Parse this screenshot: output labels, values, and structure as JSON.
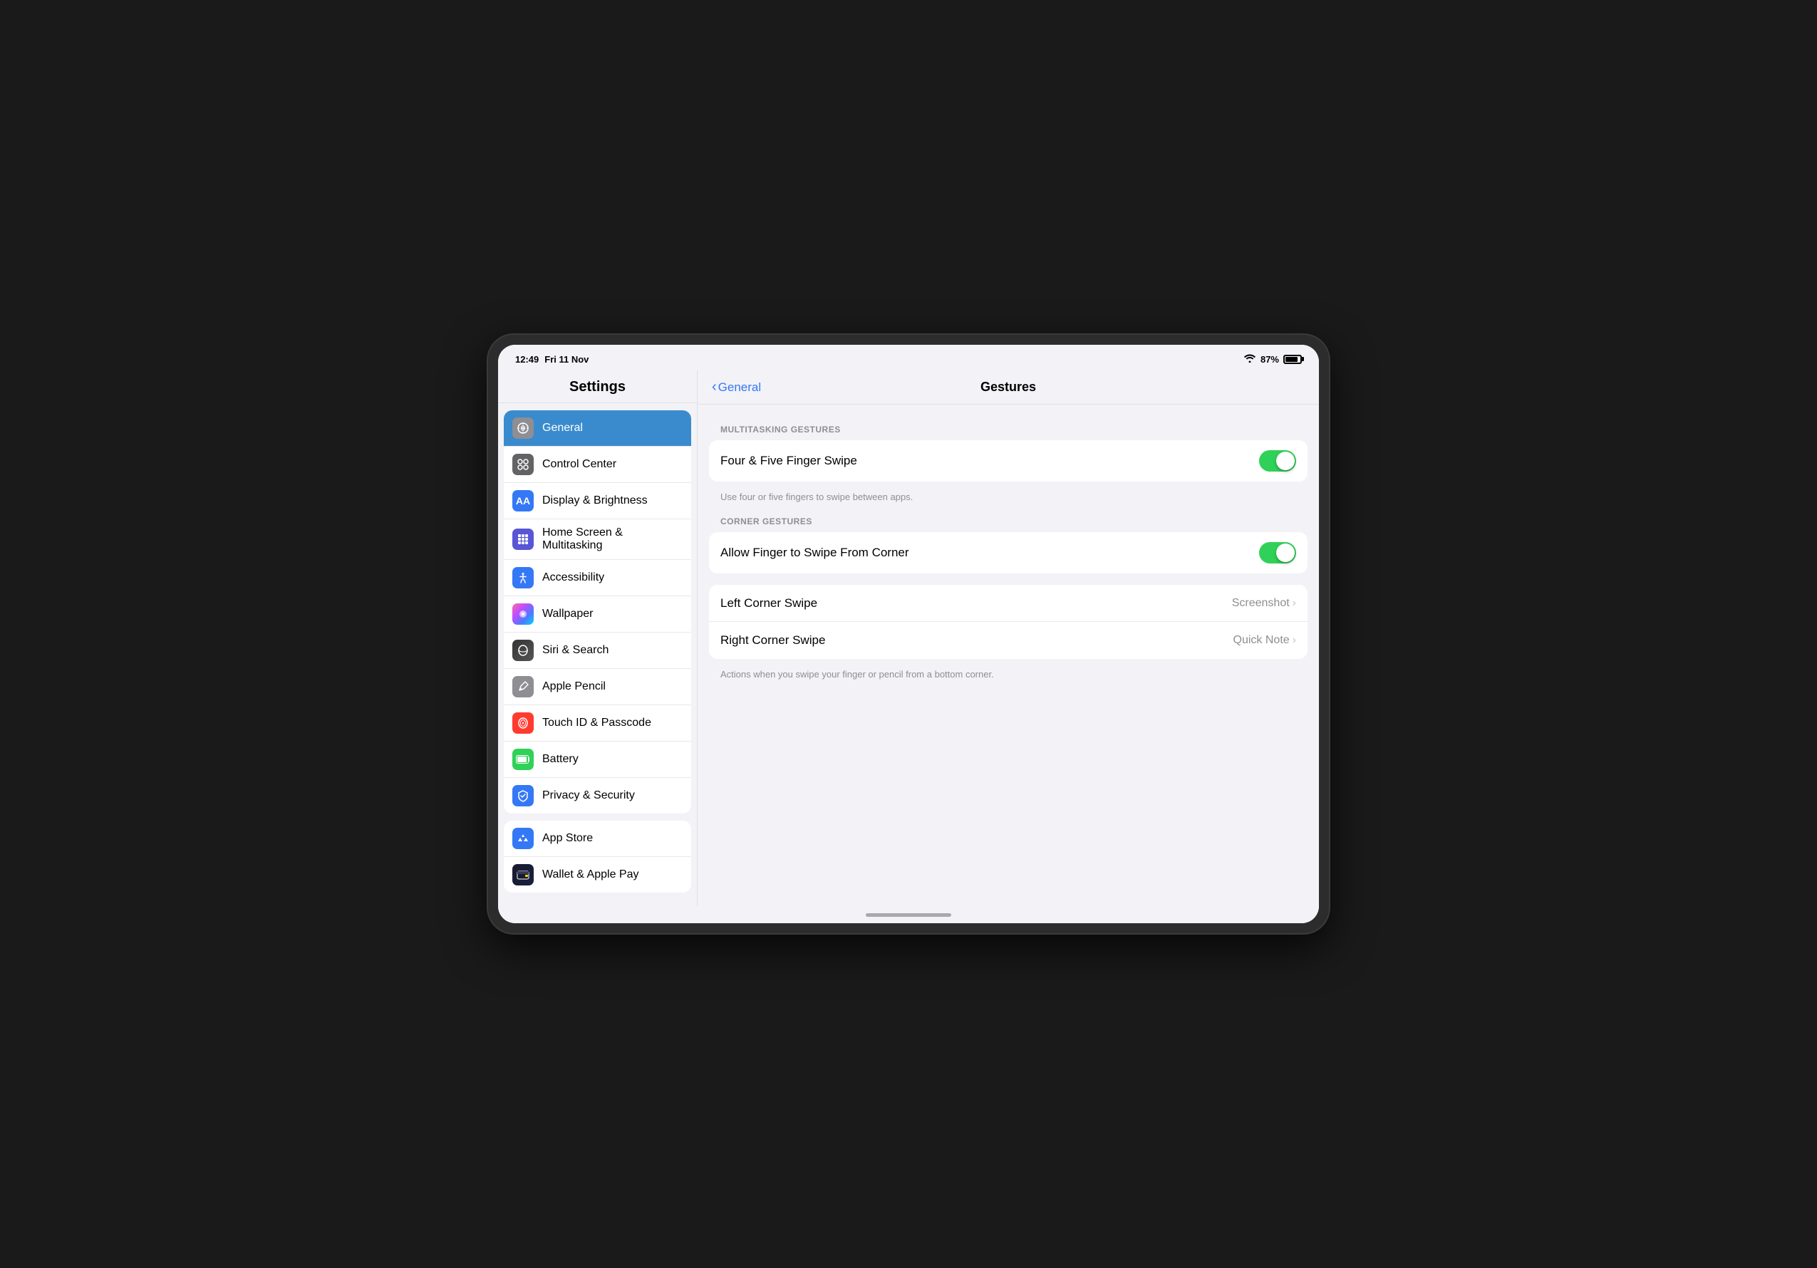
{
  "status_bar": {
    "time": "12:49",
    "date": "Fri 11 Nov",
    "battery_percent": "87%",
    "wifi": "wifi"
  },
  "sidebar": {
    "title": "Settings",
    "sections": [
      {
        "items": [
          {
            "id": "general",
            "label": "General",
            "icon_class": "icon-general",
            "active": true
          },
          {
            "id": "control",
            "label": "Control Center",
            "icon_class": "icon-control",
            "active": false
          },
          {
            "id": "display",
            "label": "Display & Brightness",
            "icon_class": "icon-display",
            "active": false
          },
          {
            "id": "homescreen",
            "label": "Home Screen & Multitasking",
            "icon_class": "icon-homescreen",
            "active": false
          },
          {
            "id": "accessibility",
            "label": "Accessibility",
            "icon_class": "icon-accessibility",
            "active": false
          },
          {
            "id": "wallpaper",
            "label": "Wallpaper",
            "icon_class": "icon-wallpaper",
            "active": false
          },
          {
            "id": "siri",
            "label": "Siri & Search",
            "icon_class": "icon-siri",
            "active": false
          },
          {
            "id": "pencil",
            "label": "Apple Pencil",
            "icon_class": "icon-pencil",
            "active": false
          },
          {
            "id": "touchid",
            "label": "Touch ID & Passcode",
            "icon_class": "icon-touchid",
            "active": false
          },
          {
            "id": "battery",
            "label": "Battery",
            "icon_class": "icon-battery",
            "active": false
          },
          {
            "id": "privacy",
            "label": "Privacy & Security",
            "icon_class": "icon-privacy",
            "active": false
          }
        ]
      },
      {
        "items": [
          {
            "id": "appstore",
            "label": "App Store",
            "icon_class": "icon-appstore",
            "active": false
          },
          {
            "id": "wallet",
            "label": "Wallet & Apple Pay",
            "icon_class": "icon-wallet",
            "active": false
          }
        ]
      }
    ]
  },
  "right_panel": {
    "back_label": "General",
    "title": "Gestures",
    "sections": [
      {
        "header": "MULTITASKING GESTURES",
        "group": [
          {
            "label": "Four & Five Finger Swipe",
            "type": "toggle",
            "value": true,
            "note": "Use four or five fingers to swipe between apps."
          }
        ]
      },
      {
        "header": "CORNER GESTURES",
        "group": [
          {
            "label": "Allow Finger to Swipe From Corner",
            "type": "toggle",
            "value": true,
            "note": null
          }
        ]
      },
      {
        "header": null,
        "group": [
          {
            "label": "Left Corner Swipe",
            "type": "nav",
            "value": "Screenshot",
            "note": null
          },
          {
            "label": "Right Corner Swipe",
            "type": "nav",
            "value": "Quick Note",
            "note": null
          }
        ],
        "footer": "Actions when you swipe your finger or pencil from a bottom corner."
      }
    ]
  }
}
